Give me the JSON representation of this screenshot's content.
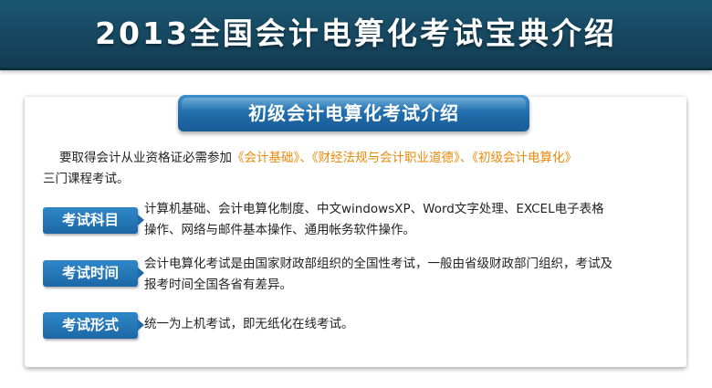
{
  "header": {
    "title": "2013全国会计电算化考试宝典介绍"
  },
  "section": {
    "title": "初级会计电算化考试介绍"
  },
  "intro": {
    "prefix": "要取得会计从业资格证必需参加",
    "courses": "《会计基础》、《财经法规与会计职业道德》、《初级会计电算化》",
    "suffix": "三门课程考试。"
  },
  "items": [
    {
      "label": "考试科目",
      "line1": "计算机基础、会计电算化制度、中文windowsXP、Word文字处理、EXCEL电子表格",
      "line2": "操作、网络与邮件基本操作、通用帐务软件操作。"
    },
    {
      "label": "考试时间",
      "line1": "会计电算化考试是由国家财政部组织的全国性考试，一般由省级财政部门组织，考试及",
      "line2": "报考时间全国各省有差异。"
    },
    {
      "label": "考试形式",
      "line1": "统一为上机考试，即无纸化在线考试。",
      "line2": ""
    }
  ],
  "colors": {
    "header_bg": "#174a63",
    "accent_blue": "#1f6aa8",
    "highlight_orange": "#e98a0b"
  }
}
